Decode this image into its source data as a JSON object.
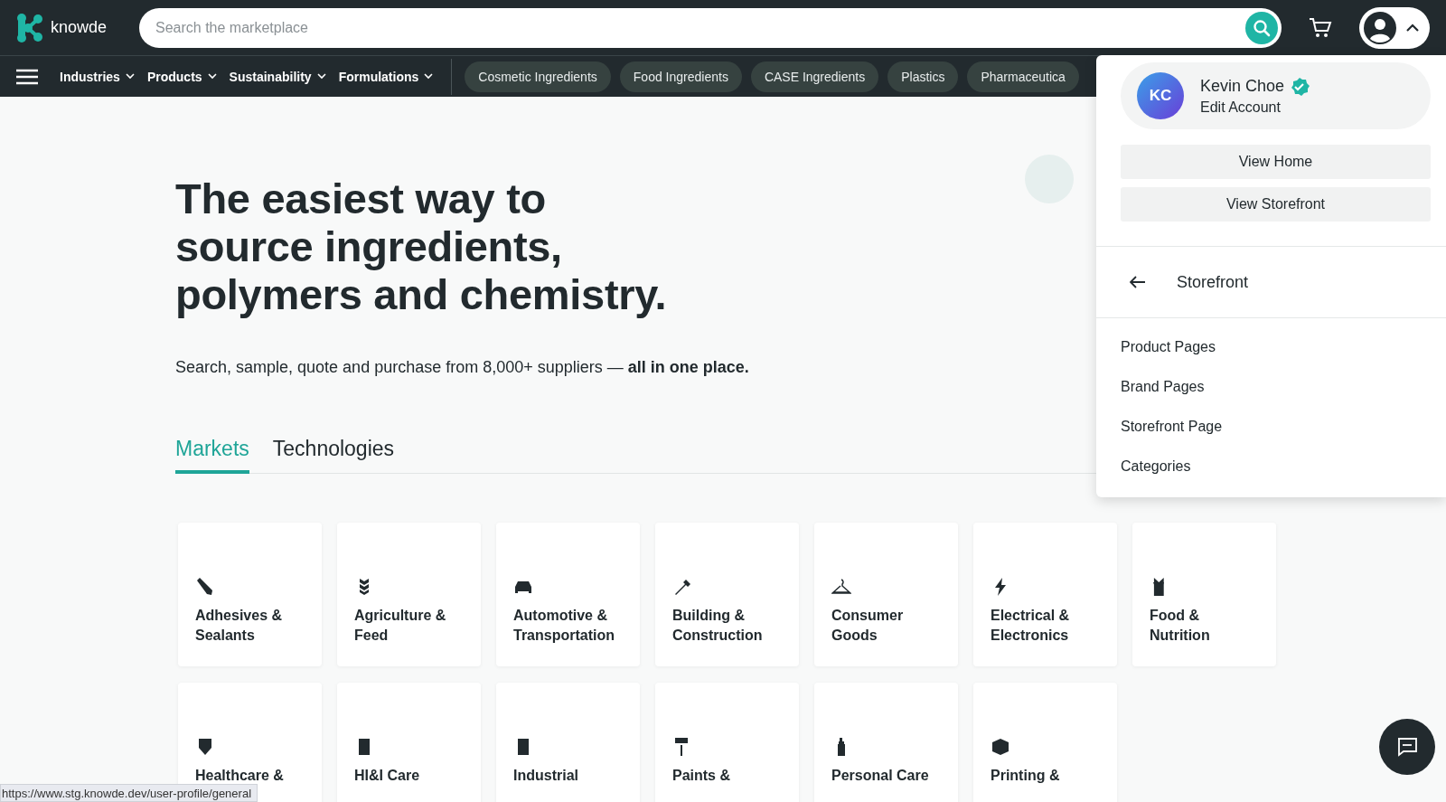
{
  "header": {
    "logo": "knowde",
    "search": {
      "placeholder": "Search the marketplace"
    }
  },
  "nav": {
    "menus": [
      "Industries",
      "Products",
      "Sustainability",
      "Formulations"
    ],
    "chips": [
      "Cosmetic Ingredients",
      "Food Ingredients",
      "CASE Ingredients",
      "Plastics",
      "Pharmaceutica"
    ]
  },
  "hero": {
    "title": "The easiest way to source ingredients, polymers and chemistry.",
    "subtitle": "Search, sample, quote and purchase from 8,000+ suppliers — **all in one place.**"
  },
  "tabs": [
    {
      "label": "Markets",
      "selected": true
    },
    {
      "label": "Technologies",
      "selected": false
    }
  ],
  "markets": [
    {
      "label": "Adhesives & Sealants"
    },
    {
      "label": "Agriculture & Feed"
    },
    {
      "label": "Automotive & Transportation"
    },
    {
      "label": "Building & Construction"
    },
    {
      "label": "Consumer Goods"
    },
    {
      "label": "Electrical & Electronics"
    },
    {
      "label": "Food & Nutrition"
    },
    {
      "label": "Healthcare &"
    },
    {
      "label": "HI&I Care"
    },
    {
      "label": "Industrial"
    },
    {
      "label": "Paints &"
    },
    {
      "label": "Personal Care"
    },
    {
      "label": "Printing &"
    }
  ],
  "profile_menu": {
    "initials": "KC",
    "name": "Kevin Choe",
    "verified": true,
    "subtitle": "Edit Account",
    "buttons": [
      "View Home",
      "View Storefront"
    ],
    "section": "Storefront",
    "items": [
      "Product Pages",
      "Brand Pages",
      "Storefront Page",
      "Categories"
    ]
  },
  "status_url": "https://www.stg.knowde.dev/user-profile/general"
}
